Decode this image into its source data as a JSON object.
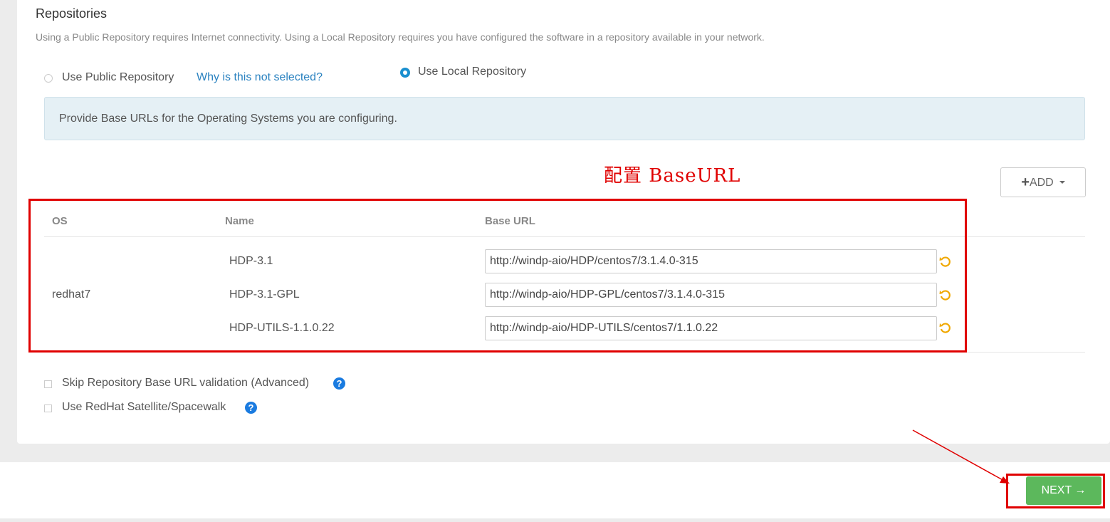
{
  "section": {
    "title": "Repositories",
    "description": "Using a Public Repository requires Internet connectivity. Using a Local Repository requires you have configured the software in a repository available in your network."
  },
  "repo_choice": {
    "public_label": "Use Public Repository",
    "why_link": "Why is this not selected?",
    "local_label": "Use Local Repository",
    "selected": "local"
  },
  "info": {
    "text": "Provide Base URLs for the Operating Systems you are configuring."
  },
  "annotation": {
    "text": "配置 BaseURL",
    "color": "#e00000"
  },
  "add_button": {
    "label": "ADD"
  },
  "table": {
    "headers": {
      "os": "OS",
      "name": "Name",
      "base_url": "Base URL"
    },
    "os": "redhat7",
    "rows": [
      {
        "name": "HDP-3.1",
        "url": "http://windp-aio/HDP/centos7/3.1.4.0-315"
      },
      {
        "name": "HDP-3.1-GPL",
        "url": "http://windp-aio/HDP-GPL/centos7/3.1.4.0-315"
      },
      {
        "name": "HDP-UTILS-1.1.0.22",
        "url": "http://windp-aio/HDP-UTILS/centos7/1.1.0.22"
      }
    ]
  },
  "options": {
    "skip_validation": "Skip Repository Base URL validation (Advanced)",
    "use_satellite": "Use RedHat Satellite/Spacewalk"
  },
  "next_button": {
    "label": "NEXT →"
  },
  "colors": {
    "accent": "#1a8fcf",
    "next": "#5cb85c",
    "undo": "#f0a800",
    "help": "#1a7be0"
  }
}
